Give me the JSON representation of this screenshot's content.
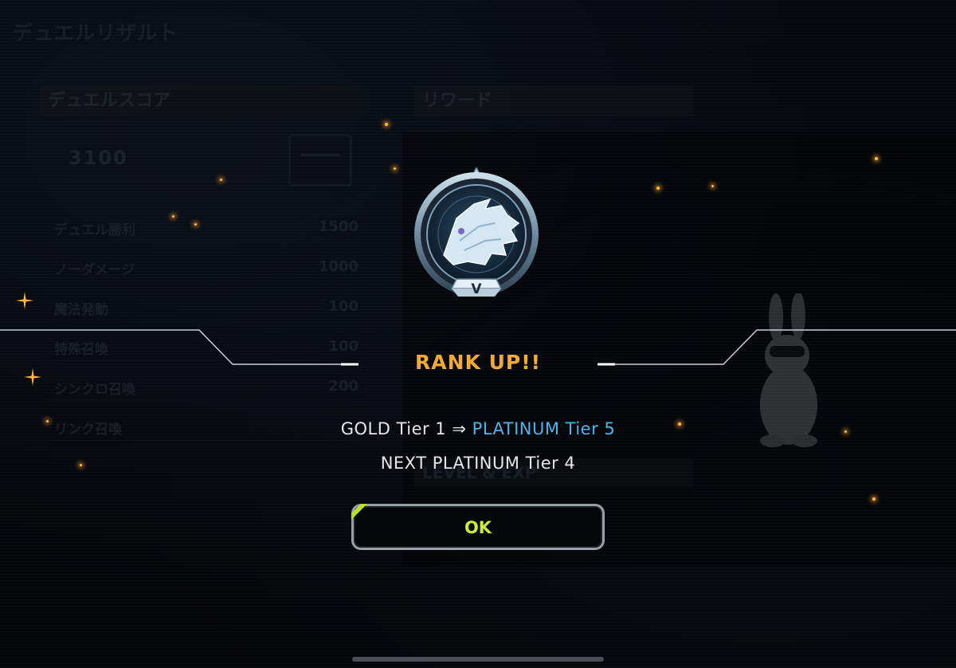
{
  "background": {
    "page_title": "デュエルリザルト",
    "score_panel": {
      "title": "デュエルスコア",
      "total": "3100",
      "rows": [
        {
          "label": "デュエル勝利",
          "value": "1500"
        },
        {
          "label": "ノーダメージ",
          "value": "1000"
        },
        {
          "label": "魔法発動",
          "value": "100"
        },
        {
          "label": "特殊召喚",
          "value": "100"
        },
        {
          "label": "シンクロ召喚",
          "value": "200"
        },
        {
          "label": "リンク召喚",
          "value": ""
        }
      ]
    },
    "reward_panel": {
      "title": "リワード"
    },
    "level_panel": {
      "title": "LEVEL & EXP"
    }
  },
  "modal": {
    "badge_tier_numeral": "V",
    "badge_icon": "wolf-emblem-icon",
    "heading": "RANK UP!!",
    "from_rank": "GOLD Tier 1",
    "arrow": "⇒",
    "to_rank": "PLATINUM Tier 5",
    "next_rank": "NEXT PLATINUM Tier 4",
    "ok_label": "OK"
  },
  "colors": {
    "heading": "#f2a93b",
    "to_rank": "#4fb4e8",
    "ok_label": "#c9ec3f",
    "accent_corner": "#b8e02a"
  }
}
